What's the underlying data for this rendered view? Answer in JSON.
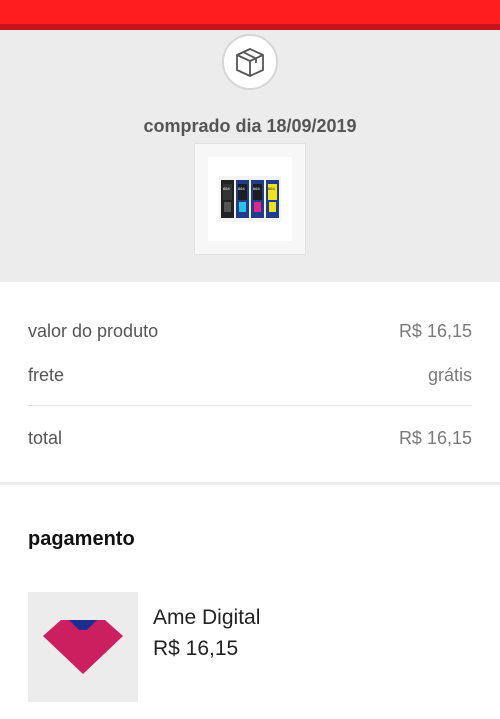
{
  "header": {
    "badge_icon": "box-icon",
    "purchase_date": "comprado dia 18/09/2019",
    "product_image": "ink-bottles-product-image"
  },
  "summary": {
    "product_value_label": "valor do produto",
    "product_value": "R$ 16,15",
    "shipping_label": "frete",
    "shipping_value": "grátis",
    "total_label": "total",
    "total_value": "R$ 16,15"
  },
  "payment": {
    "title": "pagamento",
    "logo_icon": "ame-logo-icon",
    "method": "Ame Digital",
    "amount": "R$ 16,15"
  },
  "colors": {
    "brand_red": "#ff1e1e",
    "ame_magenta": "#cc1f5f",
    "ame_blue": "#1c2f8f"
  }
}
